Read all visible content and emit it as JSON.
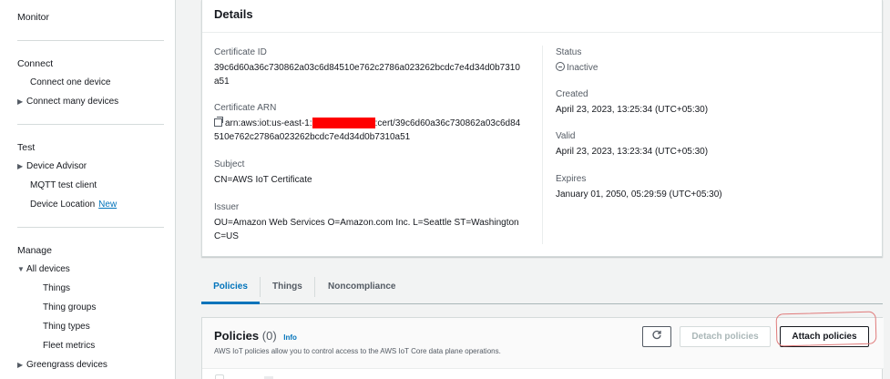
{
  "sidebar": {
    "monitor": "Monitor",
    "connect": {
      "title": "Connect",
      "items": [
        "Connect one device",
        "Connect many devices"
      ]
    },
    "test": {
      "title": "Test",
      "items": [
        "Device Advisor",
        "MQTT test client",
        "Device Location"
      ],
      "new_badge": "New"
    },
    "manage": {
      "title": "Manage",
      "all_devices": "All devices",
      "items": [
        "Things",
        "Thing groups",
        "Thing types",
        "Fleet metrics"
      ],
      "greengrass": "Greengrass devices"
    }
  },
  "details": {
    "title": "Details",
    "certificate_id_label": "Certificate ID",
    "certificate_id_line1": "39c6d60a36c730862a03c6d84510e762c2786a023262bcdc7e4d34d0b7310",
    "certificate_id_line2": "a51",
    "certificate_arn_label": "Certificate ARN",
    "certificate_arn_prefix": "arn:aws:iot:us-east-1:",
    "certificate_arn_suffix": ":cert/39c6d60a36c730862a03c6d84",
    "certificate_arn_line2": "510e762c2786a023262bcdc7e4d34d0b7310a51",
    "subject_label": "Subject",
    "subject_value": "CN=AWS IoT Certificate",
    "issuer_label": "Issuer",
    "issuer_line1": "OU=Amazon Web Services O=Amazon.com Inc. L=Seattle ST=Washington",
    "issuer_line2": "C=US",
    "status_label": "Status",
    "status_value": "Inactive",
    "created_label": "Created",
    "created_value": "April 23, 2023, 13:25:34 (UTC+05:30)",
    "valid_label": "Valid",
    "valid_value": "April 23, 2023, 13:23:34 (UTC+05:30)",
    "expires_label": "Expires",
    "expires_value": "January 01, 2050, 05:29:59 (UTC+05:30)"
  },
  "tabs": [
    "Policies",
    "Things",
    "Noncompliance"
  ],
  "active_tab": "Policies",
  "policies": {
    "title": "Policies",
    "count": "(0)",
    "info": "Info",
    "description": "AWS IoT policies allow you to control access to the AWS IoT Core data plane operations.",
    "refresh_icon": "refresh-icon",
    "detach_label": "Detach policies",
    "attach_label": "Attach policies"
  },
  "colors": {
    "accent": "#0073bb",
    "redaction": "#ff0000",
    "annotation": "#e07a7a"
  }
}
